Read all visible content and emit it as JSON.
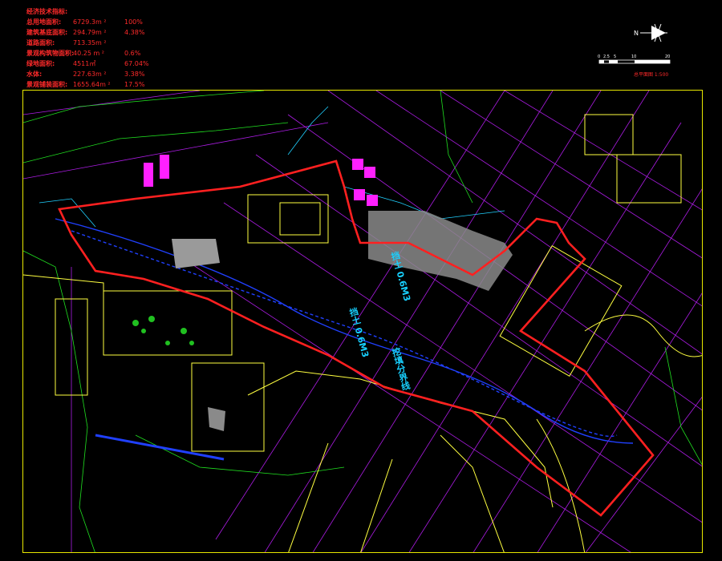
{
  "legend": {
    "title": "经济技术指标:",
    "rows": [
      {
        "label": "总用地面积:",
        "value": "6729.3m ²",
        "pct": "100%"
      },
      {
        "label": "建筑基底面积:",
        "value": "294.79m ²",
        "pct": "4.38%"
      },
      {
        "label": "道路面积:",
        "value": "713.35m ²",
        "pct": ""
      },
      {
        "label": "景观构筑物面积:",
        "value": "40.25 m ²",
        "pct": "0.6%"
      },
      {
        "label": "绿地面积:",
        "value": "4511㎡",
        "pct": "67.04%"
      },
      {
        "label": "水体:",
        "value": "227.63m ²",
        "pct": "3.38%"
      },
      {
        "label": "景观铺装面积:",
        "value": "1655.64m ²",
        "pct": "17.5%"
      }
    ]
  },
  "north_label": "N",
  "scale": {
    "ticks": [
      "0",
      "2.5",
      "5",
      "10",
      "20"
    ],
    "caption": "总平面图 1:500"
  },
  "plan_labels": {
    "label_a": "挡土 0.6M3",
    "label_b": "挡土 0.6M3",
    "label_c": "挖填分界线"
  },
  "colors": {
    "background": "#000000",
    "boundary": "#ff2020",
    "grid": "#c020ff",
    "buildings": "#ffff40",
    "water": "#2020ff",
    "text": "#ff2a2a"
  }
}
